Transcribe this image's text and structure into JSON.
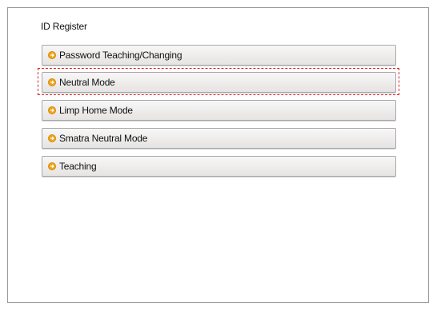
{
  "page": {
    "title": "ID Register"
  },
  "menu": {
    "items": [
      {
        "label": "Password Teaching/Changing",
        "icon": "arrow-right-circle-icon"
      },
      {
        "label": "Neutral Mode",
        "icon": "arrow-right-circle-icon",
        "highlighted": true
      },
      {
        "label": "Limp Home Mode",
        "icon": "arrow-right-circle-icon"
      },
      {
        "label": "Smatra Neutral Mode",
        "icon": "arrow-right-circle-icon"
      },
      {
        "label": "Teaching",
        "icon": "arrow-right-circle-icon"
      }
    ]
  },
  "colors": {
    "icon": "#f2a51a",
    "highlight_border": "#e02020",
    "frame_border": "#9a9a9a"
  }
}
